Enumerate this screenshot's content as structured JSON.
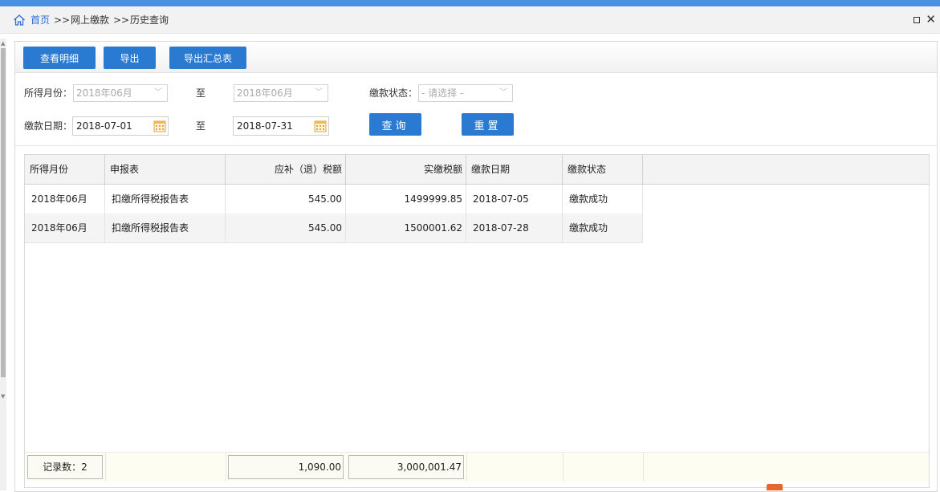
{
  "breadcrumb": {
    "home": "首页",
    "sep1": ">>",
    "level2": "网上缴款",
    "sep2": ">>",
    "current": "历史查询"
  },
  "window": {
    "close_glyph": "✕"
  },
  "toolbar": {
    "view_detail": "查看明细",
    "export": "导出",
    "export_summary": "导出汇总表"
  },
  "filters": {
    "income_month_label": "所得月份：",
    "income_month_from": "2018年06月",
    "to_label": "至",
    "income_month_to": "2018年06月",
    "pay_status_label": "缴款状态：",
    "pay_status_placeholder": "- 请选择 -",
    "pay_date_label": "缴款日期：",
    "pay_date_from": "2018-07-01",
    "pay_date_to": "2018-07-31",
    "query_button": "查询",
    "reset_button": "重置"
  },
  "table": {
    "columns": [
      "所得月份",
      "申报表",
      "应补（退）税额",
      "实缴税额",
      "缴款日期",
      "缴款状态"
    ],
    "rows": [
      [
        "2018年06月",
        "扣缴所得税报告表",
        "545.00",
        "1499999.85",
        "2018-07-05",
        "缴款成功"
      ],
      [
        "2018年06月",
        "扣缴所得税报告表",
        "545.00",
        "1500001.62",
        "2018-07-28",
        "缴款成功"
      ]
    ],
    "footer": {
      "record_count": "记录数：2",
      "total_due": "1,090.00",
      "total_paid": "3,000,001.47"
    }
  },
  "colors": {
    "accent": "#2a7ad2",
    "top_bar": "#4a90e2",
    "link": "#2a6fd1"
  }
}
